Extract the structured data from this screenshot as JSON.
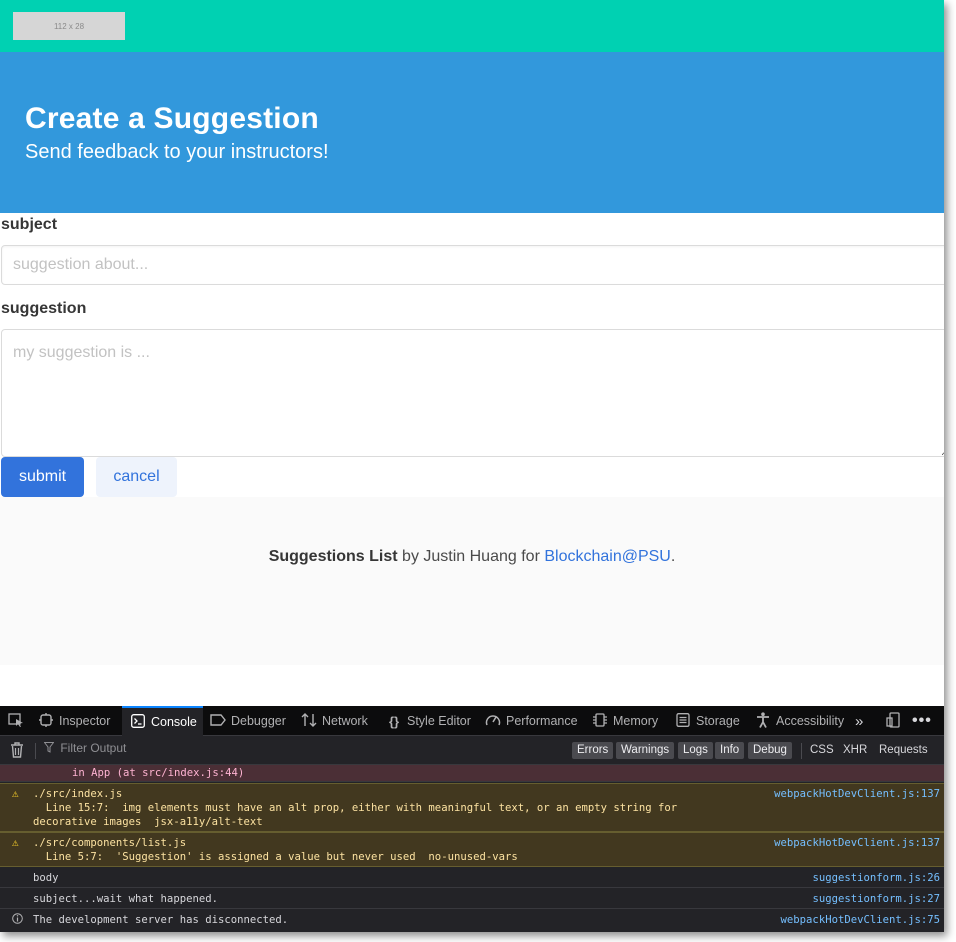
{
  "navbar": {
    "logo_placeholder": "112 x 28"
  },
  "hero": {
    "title": "Create a Suggestion",
    "subtitle": "Send feedback to your instructors!"
  },
  "form": {
    "subject_label": "subject",
    "subject_placeholder": "suggestion about...",
    "subject_value": "",
    "suggestion_label": "suggestion",
    "suggestion_placeholder": "my suggestion is ...",
    "suggestion_value": "",
    "submit_label": "submit",
    "cancel_label": "cancel"
  },
  "footer": {
    "app_name": "Suggestions List",
    "by_text": " by Justin Huang for ",
    "link_text": "Blockchain@PSU",
    "end": "."
  },
  "devtools": {
    "tabs": [
      {
        "label": "",
        "icon": "pick-element-icon"
      },
      {
        "label": "Inspector",
        "icon": "inspector-icon"
      },
      {
        "label": "Console",
        "icon": "console-icon",
        "active": true
      },
      {
        "label": "Debugger",
        "icon": "debugger-icon"
      },
      {
        "label": "Network",
        "icon": "network-icon"
      },
      {
        "label": "Style Editor",
        "icon": "style-editor-icon"
      },
      {
        "label": "Performance",
        "icon": "performance-icon"
      },
      {
        "label": "Memory",
        "icon": "memory-icon"
      },
      {
        "label": "Storage",
        "icon": "storage-icon"
      },
      {
        "label": "Accessibility",
        "icon": "accessibility-icon"
      }
    ],
    "filter_placeholder": "Filter Output",
    "levels": [
      "Errors",
      "Warnings",
      "Logs",
      "Info",
      "Debug"
    ],
    "request_filters": [
      "CSS",
      "XHR",
      "Requests"
    ],
    "logs": [
      {
        "level": "error",
        "message": "in App (at src/index.js:44)",
        "source": ""
      },
      {
        "level": "warn",
        "message": "./src/index.js\n  Line 15:7:  img elements must have an alt prop, either with meaningful text, or an empty string for\ndecorative images  jsx-a11y/alt-text",
        "source": "webpackHotDevClient.js:137"
      },
      {
        "level": "warn",
        "message": "./src/components/list.js\n  Line 5:7:  'Suggestion' is assigned a value but never used  no-unused-vars",
        "source": "webpackHotDevClient.js:137"
      },
      {
        "level": "log",
        "message": "body",
        "source": "suggestionform.js:26"
      },
      {
        "level": "log",
        "message": "subject...wait what happened.",
        "source": "suggestionform.js:27"
      },
      {
        "level": "info",
        "message": "The development server has disconnected.",
        "source": "webpackHotDevClient.js:75"
      }
    ]
  },
  "colors": {
    "navbar": "#00d1b2",
    "hero": "#3298dc",
    "primary": "#3273dc",
    "devtools_bg": "#232327"
  }
}
